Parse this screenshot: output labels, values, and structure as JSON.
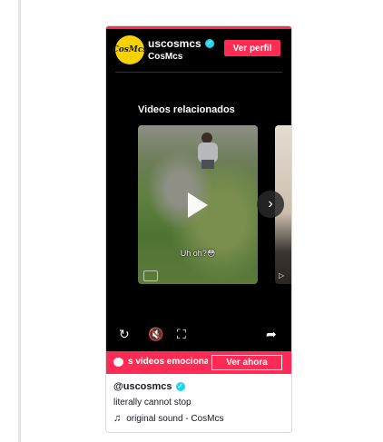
{
  "embed": {
    "avatar_text": "CosMcs",
    "handle": "uscosmcs",
    "display_name": "CosMcs",
    "view_profile_label": "Ver perfil",
    "related_title": "Videos relacionados",
    "video_overlay_text": "Uh oh?😳",
    "next_icon": "chevron-right-icon"
  },
  "controls": {
    "replay": "↻",
    "mute": "🔇",
    "fullscreen": "⛶",
    "share": "➦"
  },
  "banner": {
    "marquee_text": "s videos emocionan",
    "cta_label": "Ver ahora"
  },
  "meta": {
    "handle": "@uscosmcs",
    "caption": "literally cannot stop",
    "sound": "original sound - CosMcs"
  },
  "colors": {
    "accent": "#fe2c55",
    "verified": "#20d5ec",
    "player_bg": "#000000"
  }
}
